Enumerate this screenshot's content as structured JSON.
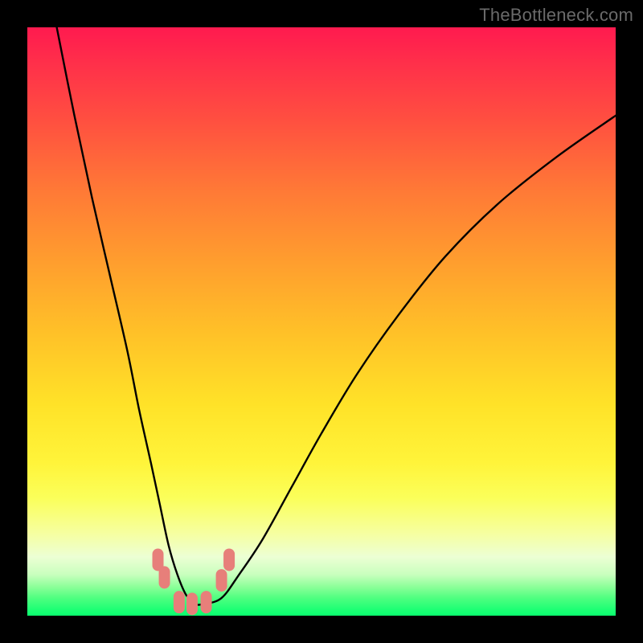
{
  "watermark": "TheBottleneck.com",
  "chart_data": {
    "type": "line",
    "title": "",
    "xlabel": "",
    "ylabel": "",
    "xlim": [
      0,
      100
    ],
    "ylim": [
      0,
      100
    ],
    "grid": false,
    "legend": false,
    "annotations": [],
    "background": {
      "type": "vertical_gradient",
      "stops": [
        {
          "pos": 0.0,
          "color": "#ff1a4f"
        },
        {
          "pos": 0.28,
          "color": "#ff7a36"
        },
        {
          "pos": 0.64,
          "color": "#ffe228"
        },
        {
          "pos": 0.86,
          "color": "#f6ffa0"
        },
        {
          "pos": 0.97,
          "color": "#4fff80"
        },
        {
          "pos": 1.0,
          "color": "#0aff6e"
        }
      ]
    },
    "series": [
      {
        "name": "bottleneck-curve",
        "color": "#000000",
        "x": [
          5,
          8,
          11,
          14,
          17,
          19,
          21,
          22.5,
          24,
          25.5,
          27,
          28.5,
          30,
          33,
          36,
          40,
          45,
          50,
          56,
          63,
          71,
          80,
          90,
          100
        ],
        "y": [
          100,
          85,
          71,
          58,
          45,
          35,
          26,
          19,
          12,
          7,
          3.5,
          2,
          2,
          3,
          7,
          13,
          22,
          31,
          41,
          51,
          61,
          70,
          78,
          85
        ]
      }
    ],
    "markers": [
      {
        "name": "marker-left-upper",
        "x": 22.2,
        "y": 9.5,
        "color": "#e77f7a"
      },
      {
        "name": "marker-left-lower",
        "x": 23.3,
        "y": 6.5,
        "color": "#e77f7a"
      },
      {
        "name": "marker-bottom-1",
        "x": 25.8,
        "y": 2.3,
        "color": "#e77f7a"
      },
      {
        "name": "marker-bottom-2",
        "x": 28.0,
        "y": 2.0,
        "color": "#e77f7a"
      },
      {
        "name": "marker-bottom-3",
        "x": 30.4,
        "y": 2.3,
        "color": "#e77f7a"
      },
      {
        "name": "marker-right-lower",
        "x": 33.0,
        "y": 6.0,
        "color": "#e77f7a"
      },
      {
        "name": "marker-right-upper",
        "x": 34.3,
        "y": 9.5,
        "color": "#e77f7a"
      }
    ]
  }
}
